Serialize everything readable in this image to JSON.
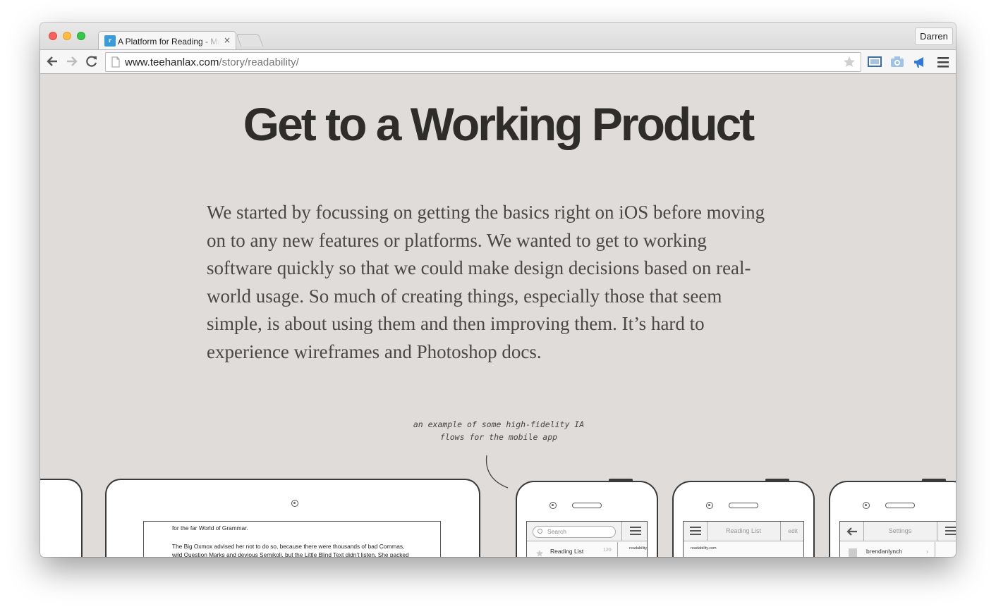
{
  "browser": {
    "tab": {
      "title": "A Platform for Reading - Making Readability",
      "favicon_text": "r",
      "close_glyph": "×"
    },
    "profile_name": "Darren",
    "url": {
      "host": "www.teehanlax.com",
      "path": "/story/readability/"
    }
  },
  "page": {
    "headline": "Get to a Working Product",
    "paragraph": "We started by focussing on getting the basics right on iOS before moving on to any new features or platforms. We wanted to get to working software quickly so that we could make design decisions based on real-world usage. So much of creating things, especially those that seem simple, is about using them and then improving them. It’s hard to experience wireframes and Photoshop docs.",
    "annotation_line1": "an example of some high-fidelity IA",
    "annotation_line2": "flows for the mobile app"
  },
  "wireframes": {
    "tablet_lines": [
      "for the far World of Grammar.",
      "The Big Oxmox advised her not to do so, because there were thousands of bad Commas,",
      "wild Question Marks and devious Semikoli, but the Little Blind Text didn’t listen. She packed"
    ],
    "phone1": {
      "search_placeholder": "Search",
      "row_label": "Reading List",
      "row_count": "120",
      "row_side": "readability"
    },
    "phone2": {
      "nav_title": "Reading List",
      "nav_edit": "edit",
      "row_source": "readability.com"
    },
    "phone3": {
      "nav_title": "Settings",
      "row_label": "brendanlynch",
      "row_chevron": "›"
    }
  },
  "colors": {
    "page_background": "#dfdcd9",
    "headline": "#2e2d2a",
    "body_text": "#4a4744",
    "favicon": "#3a9bd9"
  },
  "icons": [
    "back-arrow-icon",
    "forward-arrow-icon",
    "reload-icon",
    "page-icon",
    "star-icon",
    "fullscreen-icon",
    "camera-icon",
    "megaphone-icon",
    "hamburger-menu-icon"
  ]
}
